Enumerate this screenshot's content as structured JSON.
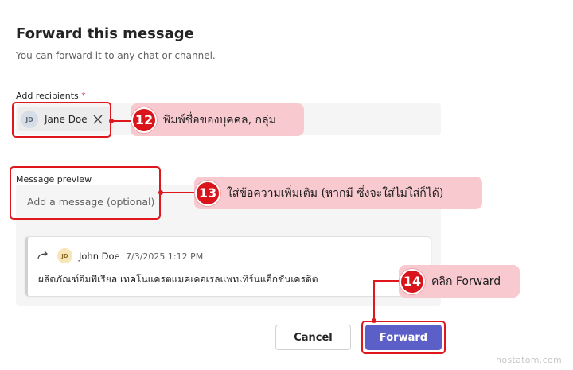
{
  "dialog": {
    "title": "Forward this message",
    "subtitle": "You can forward it to any chat or channel.",
    "recipients_label": "Add recipients",
    "required_mark": "*",
    "recipient_initials": "JD",
    "recipient_name": "Jane Doe",
    "message_label": "Message preview",
    "message_placeholder": "Add a message (optional)",
    "cancel_label": "Cancel",
    "forward_label": "Forward"
  },
  "preview": {
    "sender_initials": "JD",
    "sender_name": "John Doe",
    "timestamp": "7/3/2025 1:12 PM",
    "body": "ผลิตภัณฑ์อิมพีเรียล เทคโนแครตแมคเคอเรลแพทเทิร์นแอ็กชั่นเครดิต"
  },
  "callouts": [
    {
      "number": "12",
      "text": "พิมพ์ชื่อของบุคคล, กลุ่ม"
    },
    {
      "number": "13",
      "text": "ใส่ข้อความเพิ่มเติม (หากมี ซึ่งจะใส่ไม่ใส่ก็ได้)"
    },
    {
      "number": "14",
      "text": "คลิก Forward"
    }
  ],
  "watermark": "hostatom.com",
  "colors": {
    "accent": "#5b5fc7",
    "highlight": "#e0181e",
    "callout_bg": "#f8c9cf"
  }
}
